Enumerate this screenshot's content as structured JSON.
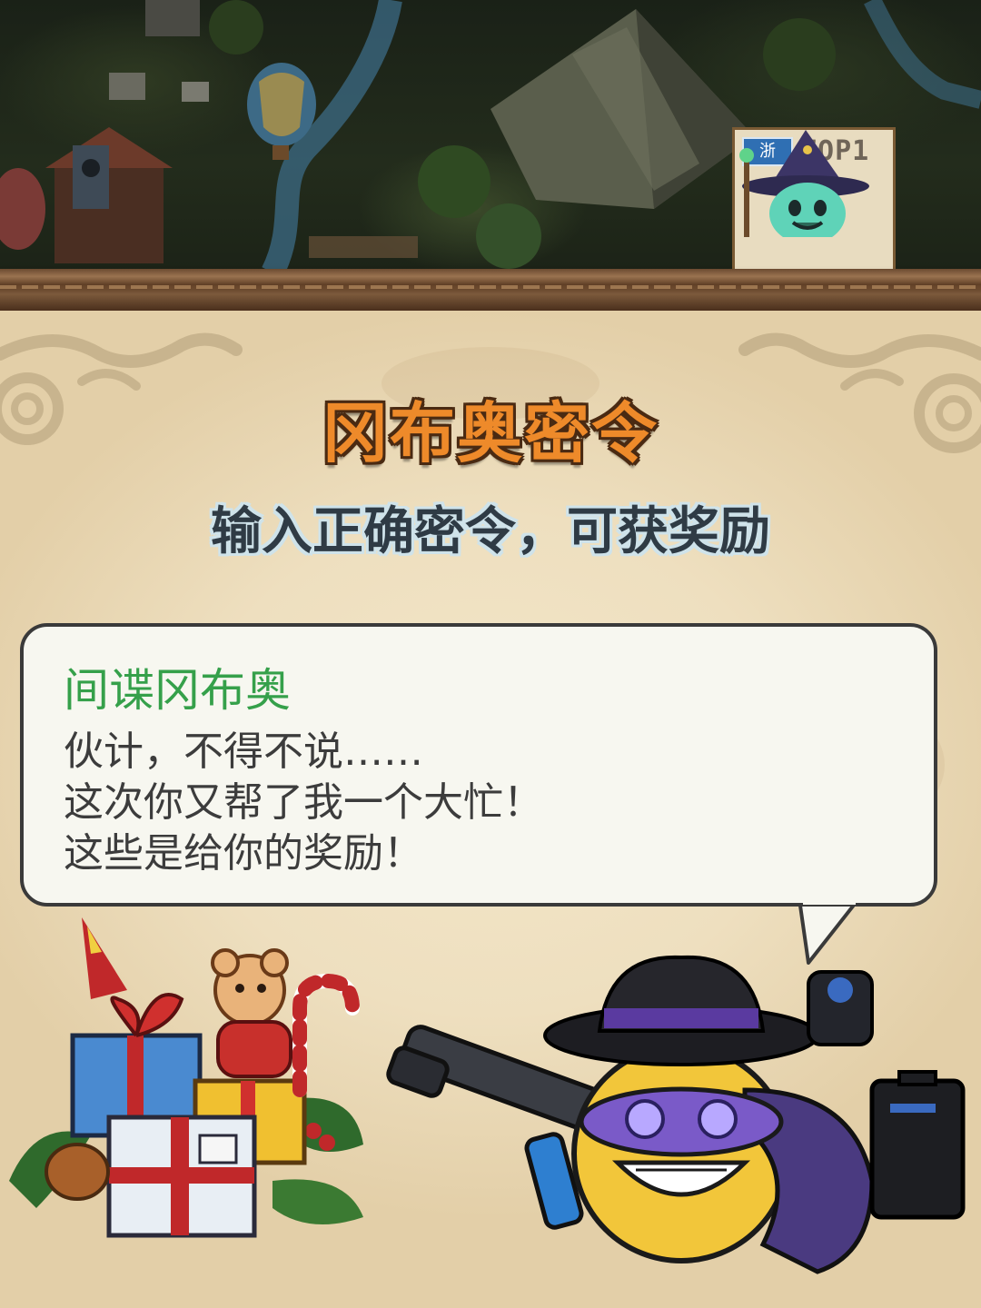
{
  "map": {
    "leaderboard_rank": "TOP1",
    "province_badge": "浙"
  },
  "panel": {
    "title": "冈布奥密令",
    "subtitle": "输入正确密令，可获奖励"
  },
  "dialog": {
    "speaker": "间谍冈布奥",
    "lines": [
      "伙计，不得不说……",
      "这次你又帮了我一个大忙！",
      "这些是给你的奖励！"
    ]
  },
  "colors": {
    "title_fill": "#ee8a2a",
    "speaker_green": "#35a04a",
    "parchment": "#eedfbf"
  }
}
